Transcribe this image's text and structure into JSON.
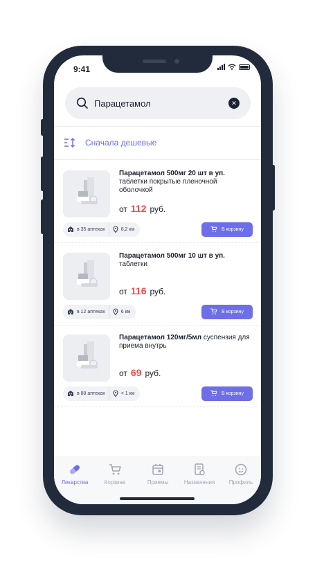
{
  "status": {
    "time": "9:41"
  },
  "search": {
    "value": "Парацетамол",
    "clear_icon": "close-icon"
  },
  "sort": {
    "label": "Сначала дешевые",
    "icon": "sort-icon"
  },
  "accent": "#6d6ee8",
  "price_color": "#ec4a4a",
  "products": [
    {
      "title": "Парацетамол 500мг 20 шт в уп.",
      "subtitle": "таблетки покрытые пленочной оболочкой",
      "price_prefix": "от",
      "price": "112",
      "currency": "руб.",
      "pharmacies": "в 35 аптеках",
      "distance": "8,2 км",
      "cart_label": "В корзину"
    },
    {
      "title": "Парацетамол 500мг 10 шт в уп.",
      "subtitle": "таблетки",
      "price_prefix": "от",
      "price": "116",
      "currency": "руб.",
      "pharmacies": "в 12 аптеках",
      "distance": "6 км",
      "cart_label": "В корзину"
    },
    {
      "title": "Парацетамол 120мг/5мл",
      "subtitle": "суспензия для приема внутрь",
      "price_prefix": "от",
      "price": "69",
      "currency": "руб.",
      "pharmacies": "в 88 аптеках",
      "distance": "< 1 км",
      "cart_label": "В корзину"
    }
  ],
  "tabs": [
    {
      "label": "Лекарства",
      "icon": "pill-icon",
      "active": true
    },
    {
      "label": "Корзина",
      "icon": "cart-icon",
      "active": false
    },
    {
      "label": "Приемы",
      "icon": "calendar-icon",
      "active": false
    },
    {
      "label": "Назначения",
      "icon": "prescription-icon",
      "active": false
    },
    {
      "label": "Профиль",
      "icon": "profile-icon",
      "active": false
    }
  ]
}
